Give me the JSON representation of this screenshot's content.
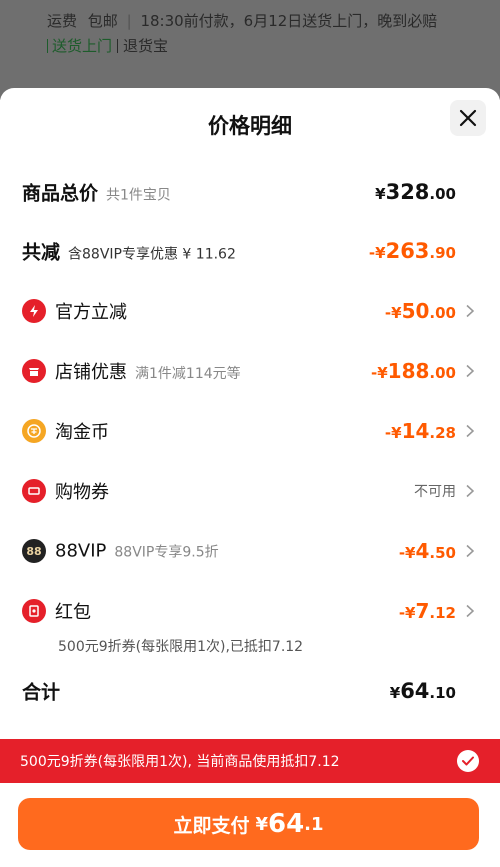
{
  "background": {
    "line1": [
      "运费",
      "包邮",
      "18:30前付款，6月12日送货上门，晚到必赔"
    ],
    "line2_highlight": "送货上门",
    "line2_plain": "退货宝"
  },
  "sheet": {
    "title": "价格明细",
    "close_icon": "close-icon"
  },
  "total_price": {
    "label": "商品总价",
    "sub": "共1件宝贝",
    "currency": "¥",
    "amount_int": "328",
    "amount_dec": ".00"
  },
  "total_discount": {
    "label": "共减",
    "sub": "含88VIP专享优惠 ¥ 11.62",
    "prefix": "-¥",
    "amount_int": "263",
    "amount_dec": ".90"
  },
  "items": [
    {
      "label": "官方立减",
      "sub": "",
      "prefix": "-¥",
      "amount_int": "50",
      "amount_dec": ".00",
      "icon": "lightning-icon",
      "color": "#e5202a"
    },
    {
      "label": "店铺优惠",
      "sub": "满1件减114元等",
      "prefix": "-¥",
      "amount_int": "188",
      "amount_dec": ".00",
      "icon": "shop-icon",
      "color": "#e5202a"
    },
    {
      "label": "淘金币",
      "sub": "",
      "prefix": "-¥",
      "amount_int": "14",
      "amount_dec": ".28",
      "icon": "coin-icon",
      "color": "#f5a623"
    },
    {
      "label": "购物券",
      "sub": "",
      "unavailable": "不可用",
      "icon": "coupon-icon",
      "color": "#e5202a"
    },
    {
      "label": "88VIP",
      "sub": "88VIP专享9.5折",
      "prefix": "-¥",
      "amount_int": "4",
      "amount_dec": ".50",
      "icon": "vip88-icon",
      "color": "#222222"
    },
    {
      "label": "红包",
      "sub": "",
      "prefix": "-¥",
      "amount_int": "7",
      "amount_dec": ".12",
      "icon": "red-packet-icon",
      "color": "#e5202a"
    }
  ],
  "red_packet_note": "500元9折券(每张限用1次),已抵扣7.12",
  "sum": {
    "label": "合计",
    "currency": "¥",
    "amount_int": "64",
    "amount_dec": ".10"
  },
  "banner": {
    "text": "500元9折券(每张限用1次), 当前商品使用抵扣7.12",
    "check_icon": "check-circle-icon"
  },
  "pay_button": {
    "label": "立即支付",
    "currency": "¥",
    "amount_int": "64",
    "amount_dec": ".1"
  },
  "colors": {
    "accent": "#ff5a00",
    "banner": "#e5202a",
    "pay": "#ff6a1e"
  }
}
